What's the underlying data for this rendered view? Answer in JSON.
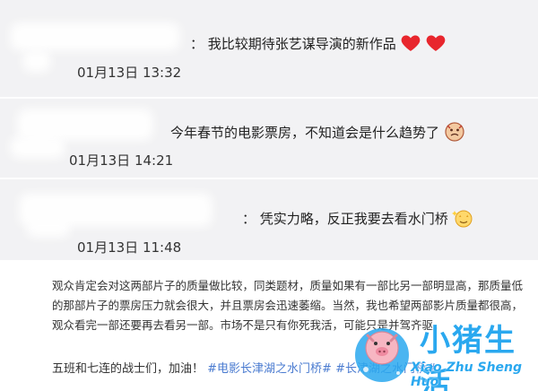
{
  "comments": [
    {
      "text": "：  我比较期待张艺谋导演的新作品",
      "time": "01月13日  13:32"
    },
    {
      "text": "今年春节的电影票房，不知道会是什么趋势了",
      "time": "01月13日  14:21"
    },
    {
      "text": "：  凭实力略，反正我要去看水门桥",
      "time": "01月13日  11:48"
    }
  ],
  "article": {
    "lines": [
      "观众肯定会对这两部片子的质量做比较，同类题材，质量如果有一部比另一部明显高，那质量低",
      "的那部片子的票房压力就会很大，并且票房会迅速萎缩。当然，我也希望两部影片质量都很高，",
      "观众看完一部还要再去看另一部。市场不是只有你死我活，可能只是并驾齐驱。"
    ],
    "slogan_prefix": "五班和七连的战士们，加油！",
    "slogan_tag": "#电影长津湖之水门桥#  #长津湖之水门桥#"
  },
  "logo": {
    "cn": "小猪生活",
    "en": "Xiao Zhu Sheng Huo"
  },
  "colors": {
    "accent": "#2aa8ef",
    "tag": "#4a7bd0",
    "heart": "#e8262d"
  }
}
